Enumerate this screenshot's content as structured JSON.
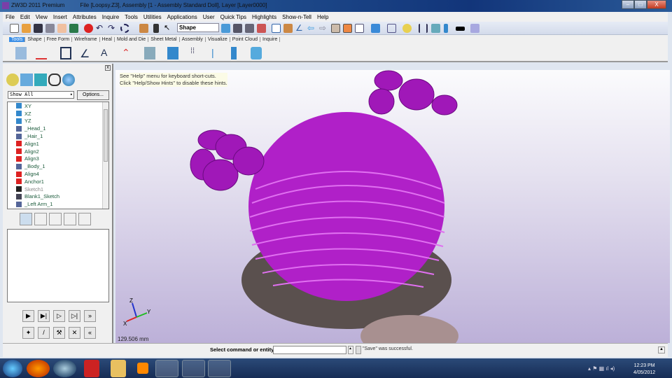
{
  "window": {
    "title": "ZW3D 2011 Premium",
    "file_info": "File [Loopsy.Z3],  Assembly [1 - Assembly Standard Doll],  Layer [Layer0000]",
    "min": "–",
    "max": "□",
    "close": "X"
  },
  "menu": [
    "File",
    "Edit",
    "View",
    "Insert",
    "Attributes",
    "Inquire",
    "Tools",
    "Utilities",
    "Applications",
    "User",
    "Quick Tips",
    "Highlights",
    "Show-n-Tell",
    "Help"
  ],
  "toolbar": {
    "filter_value": "Shape"
  },
  "ribbon_tabs": [
    "Tools",
    "Shape",
    "Free Form",
    "Wireframe",
    "Heal",
    "Mold and Die",
    "Sheet Metal",
    "Assembly",
    "Visualize",
    "Point Cloud",
    "Inquire"
  ],
  "left_panel": {
    "filter": "Show All",
    "options_button": "Options...",
    "close": "x",
    "tree": [
      {
        "label": "XY",
        "icon": "datum-plane-icon"
      },
      {
        "label": "XZ",
        "icon": "datum-plane-icon"
      },
      {
        "label": "YZ",
        "icon": "datum-plane-icon"
      },
      {
        "label": "_Head_1",
        "icon": "component-icon"
      },
      {
        "label": "_Hair_1",
        "icon": "component-icon"
      },
      {
        "label": "Align1",
        "icon": "constraint-icon"
      },
      {
        "label": "Align2",
        "icon": "constraint-icon"
      },
      {
        "label": "Align3",
        "icon": "constraint-icon"
      },
      {
        "label": "_Body_1",
        "icon": "component-icon"
      },
      {
        "label": "Align4",
        "icon": "constraint-icon"
      },
      {
        "label": "Anchor1",
        "icon": "constraint-icon"
      },
      {
        "label": "Sketch1",
        "icon": "sketch-icon"
      },
      {
        "label": "Blank1_Sketch",
        "icon": "blank-icon"
      },
      {
        "label": "_Left Arm_1",
        "icon": "component-icon"
      }
    ]
  },
  "viewport": {
    "hint_line1": "See \"Help\" menu for keyboard short-cuts.",
    "hint_line2": "Click \"Help/Show Hints\" to disable these hints.",
    "scale": "129.506 mm",
    "axis_x": "X",
    "axis_y": "Y",
    "axis_z": "Z"
  },
  "status": {
    "prompt": "Select command or entity.",
    "message": "\"Save\" was successful."
  },
  "taskbar": {
    "time": "12:23 PM",
    "date": "4/05/2012"
  },
  "colors": {
    "model": "#b020c8",
    "accent": "#3a8ee6"
  }
}
